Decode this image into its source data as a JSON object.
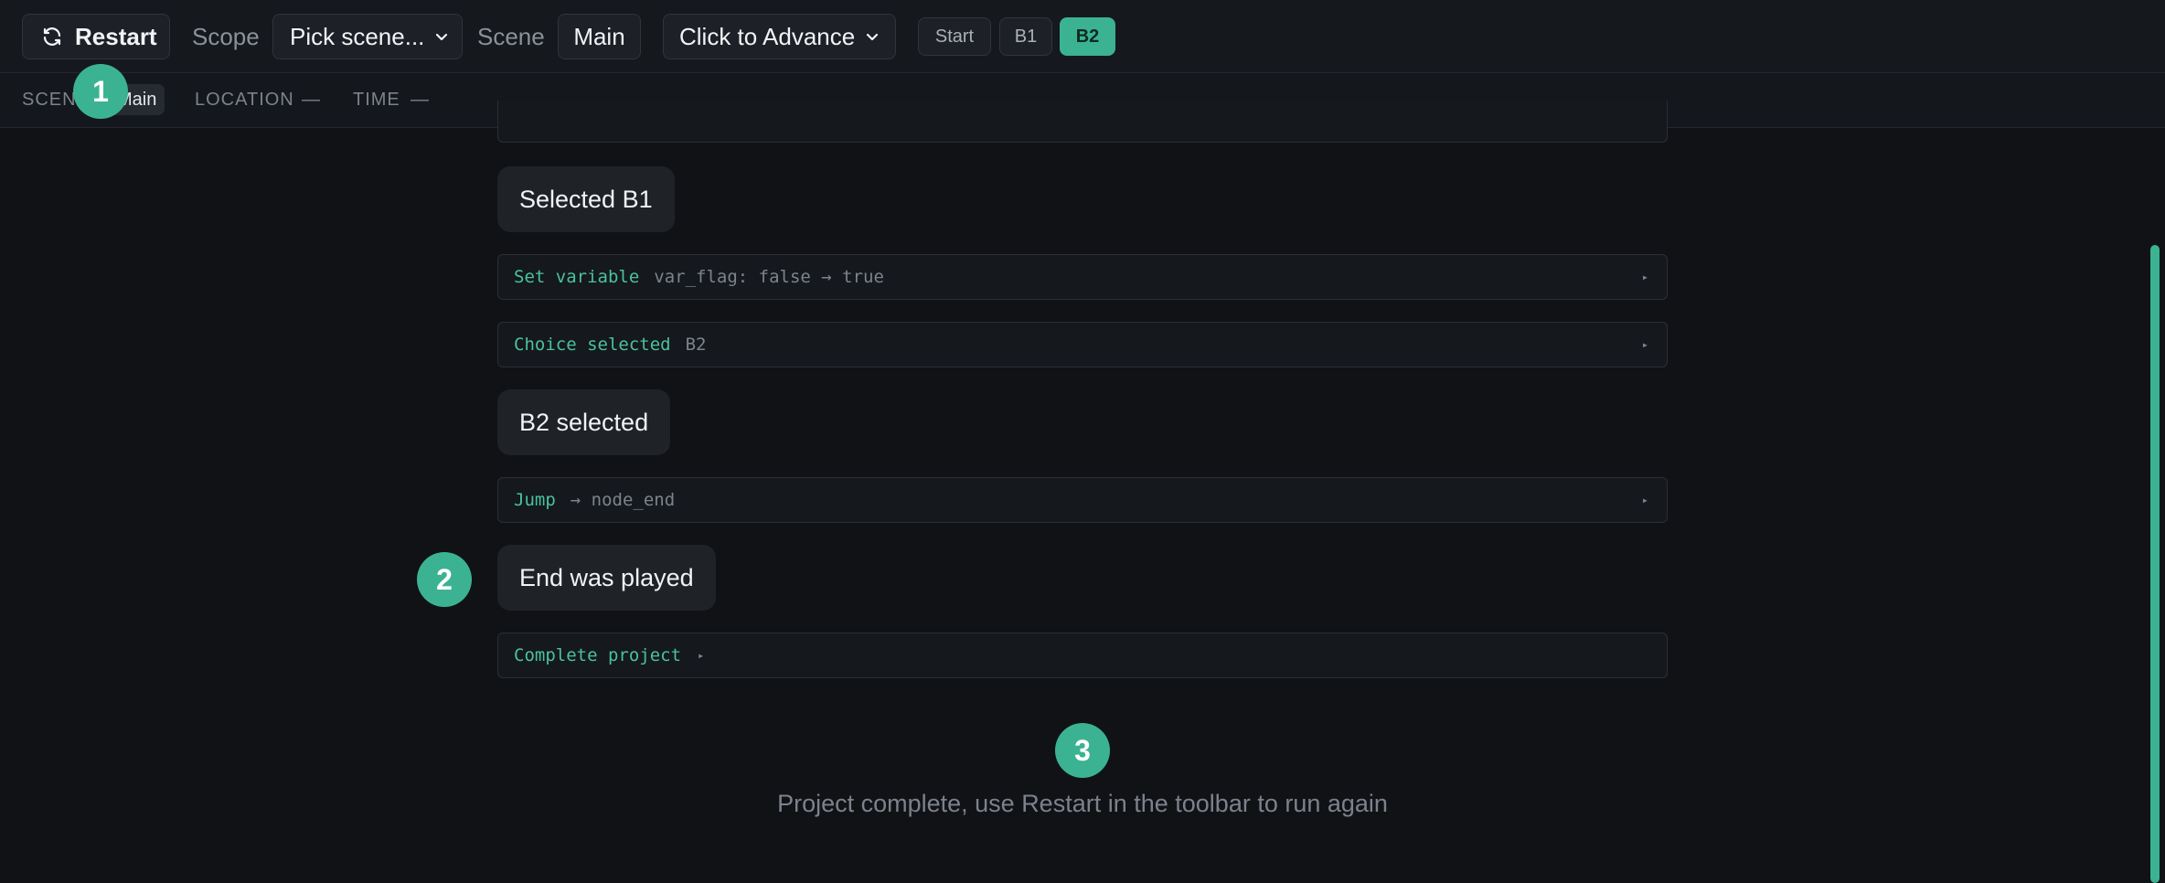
{
  "toolbar": {
    "restart_label": "Restart",
    "scope_label": "Scope",
    "scope_value": "Pick scene...",
    "scene_label": "Scene",
    "scene_value": "Main",
    "advance_value": "Click to Advance",
    "stops": [
      {
        "label": "Start",
        "active": false
      },
      {
        "label": "B1",
        "active": false
      },
      {
        "label": "B2",
        "active": true
      }
    ]
  },
  "infobar": {
    "scene_label": "SCENE",
    "scene_value": "Main",
    "location_label": "LOCATION",
    "location_value": "—",
    "time_label": "TIME",
    "time_value": "—"
  },
  "markers": [
    "1",
    "2",
    "3"
  ],
  "log": {
    "bubble_b1": "Selected B1",
    "set_variable": {
      "kind": "Set variable",
      "detail": "var_flag: false → true"
    },
    "choice": {
      "kind": "Choice selected",
      "detail": "B2"
    },
    "bubble_b2": "B2 selected",
    "jump": {
      "kind": "Jump",
      "detail": "→ node_end"
    },
    "bubble_end": "End was played",
    "complete": {
      "kind": "Complete project"
    },
    "expand_glyph": "▸"
  },
  "footer": {
    "message": "Project complete, use Restart in the toolbar to run again"
  },
  "colors": {
    "accent": "#3bb392",
    "background": "#101216",
    "surface": "#1f2227"
  },
  "icons": {
    "restart": "refresh-icon",
    "dropdown": "chevron-down-icon",
    "expand": "triangle-right-icon"
  }
}
